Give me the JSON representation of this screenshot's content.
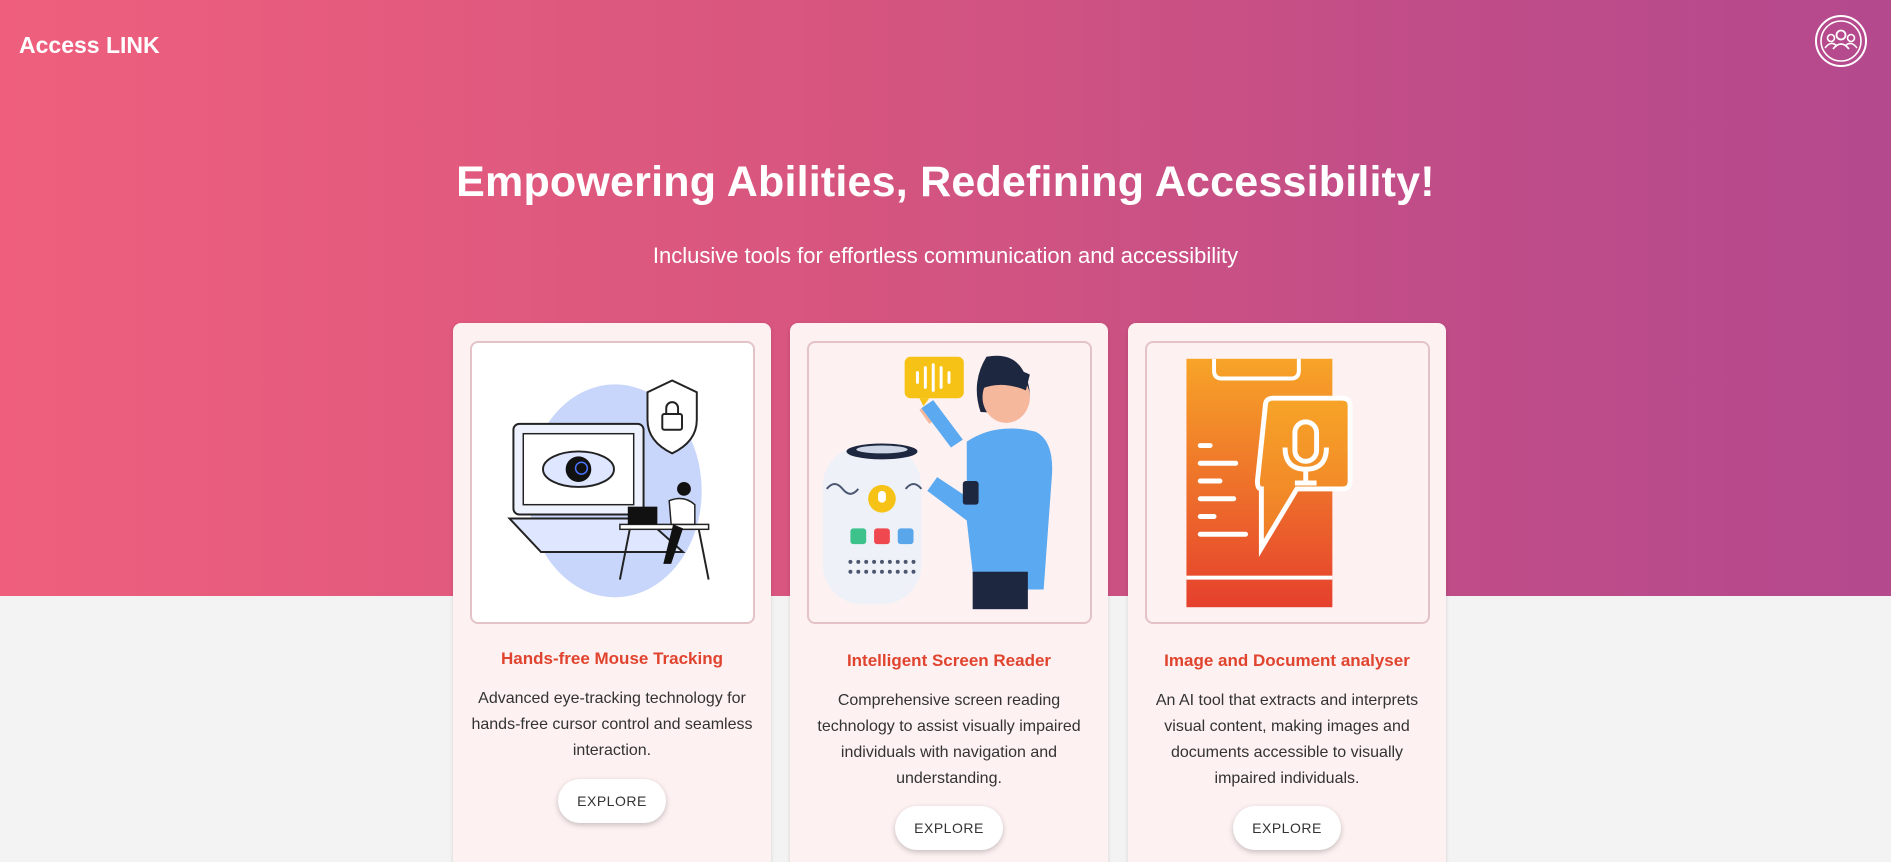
{
  "header": {
    "brand": "Access LINK",
    "profile_icon": "users-group-icon"
  },
  "hero": {
    "title": "Empowering Abilities, Redefining Accessibility!",
    "subtitle": "Inclusive tools for effortless communication and accessibility",
    "gradient_colors": [
      "#ef5f7d",
      "#b4498e"
    ]
  },
  "cards": [
    {
      "title": "Hands-free Mouse Tracking",
      "description": "Advanced eye-tracking technology for hands-free cursor control and seamless interaction.",
      "button_label": "EXPLORE",
      "illustration": "eye-tracking-laptop-illustration"
    },
    {
      "title": "Intelligent Screen Reader",
      "description": "Comprehensive screen reading technology to assist visually impaired individuals with navigation and understanding.",
      "button_label": "EXPLORE",
      "illustration": "voice-assistant-illustration"
    },
    {
      "title": "Image and Document analyser",
      "description": "An AI tool that extracts and interprets visual content, making images and documents accessible to visually impaired individuals.",
      "button_label": "EXPLORE",
      "illustration": "phone-microphone-document-illustration"
    }
  ],
  "colors": {
    "accent": "#e0442f",
    "card_bg": "#fdf1f1",
    "page_bg": "#f3f3f3"
  }
}
